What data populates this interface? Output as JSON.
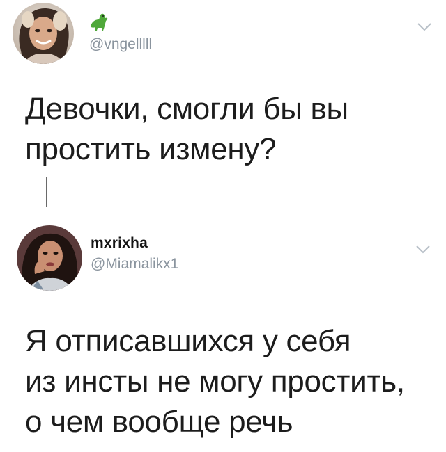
{
  "tweets": [
    {
      "display_name": "",
      "handle": "@vngelllll",
      "name_emoji": "dinosaur-emoji",
      "text_lines": [
        "Девочки, смогли бы вы",
        "простить измену?"
      ]
    },
    {
      "display_name": "mxrixha",
      "handle": "@Miamalikx1",
      "text_lines": [
        "Я отписавшихся у себя",
        "из инсты не могу простить,",
        "о чем вообще речь"
      ]
    }
  ],
  "colors": {
    "text": "#1c1c1c",
    "handle": "#8a949e",
    "chevron": "#b8c0c8",
    "thread_line": "#6a6a6a"
  },
  "icons": {
    "menu": "chevron-down-icon"
  }
}
